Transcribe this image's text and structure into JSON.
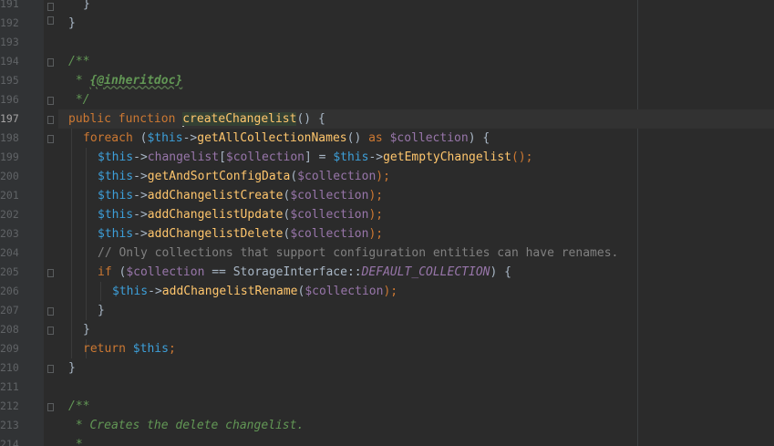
{
  "editor": {
    "line_numbers": [
      "191",
      "192",
      "193",
      "194",
      "195",
      "196",
      "197",
      "198",
      "199",
      "200",
      "201",
      "202",
      "203",
      "204",
      "205",
      "206",
      "207",
      "208",
      "209",
      "210",
      "211",
      "212",
      "213",
      "214"
    ],
    "current_line": "197",
    "lines": {
      "l191": "}",
      "l192": "}",
      "l194": "/**",
      "l195_a": " * ",
      "l195_b": "{@inheritdoc}",
      "l196": " */",
      "l197_kw": "public function ",
      "l197_fn": "createChangelist",
      "l197_rest": "() {",
      "l198_kw": "foreach",
      "l198_a": " (",
      "l198_this": "$this",
      "l198_b": "->",
      "l198_fn": "getAllCollectionNames",
      "l198_c": "() ",
      "l198_as": "as",
      "l198_d": " ",
      "l198_var": "$collection",
      "l198_e": ") {",
      "l199_this": "$this",
      "l199_a": "->",
      "l199_prop": "changelist",
      "l199_b": "[",
      "l199_var": "$collection",
      "l199_c": "] = ",
      "l199_this2": "$this",
      "l199_d": "->",
      "l199_fn": "getEmptyChangelist",
      "l199_e": "();",
      "l200_this": "$this",
      "l200_a": "->",
      "l200_fn": "getAndSortConfigData",
      "l200_b": "(",
      "l200_var": "$collection",
      "l200_c": ");",
      "l201_this": "$this",
      "l201_a": "->",
      "l201_fn": "addChangelistCreate",
      "l201_b": "(",
      "l201_var": "$collection",
      "l201_c": ");",
      "l202_this": "$this",
      "l202_a": "->",
      "l202_fn": "addChangelistUpdate",
      "l202_b": "(",
      "l202_var": "$collection",
      "l202_c": ");",
      "l203_this": "$this",
      "l203_a": "->",
      "l203_fn": "addChangelistDelete",
      "l203_b": "(",
      "l203_var": "$collection",
      "l203_c": ");",
      "l204": "// Only collections that support configuration entities can have renames.",
      "l205_kw": "if",
      "l205_a": " (",
      "l205_var": "$collection",
      "l205_b": " == StorageInterface::",
      "l205_const": "DEFAULT_COLLECTION",
      "l205_c": ") {",
      "l206_this": "$this",
      "l206_a": "->",
      "l206_fn": "addChangelistRename",
      "l206_b": "(",
      "l206_var": "$collection",
      "l206_c": ");",
      "l207": "}",
      "l208": "}",
      "l209_kw": "return",
      "l209_a": " ",
      "l209_this": "$this",
      "l209_b": ";",
      "l210": "}",
      "l212": "/**",
      "l213": " * Creates the delete changelist.",
      "l214": " *"
    }
  }
}
